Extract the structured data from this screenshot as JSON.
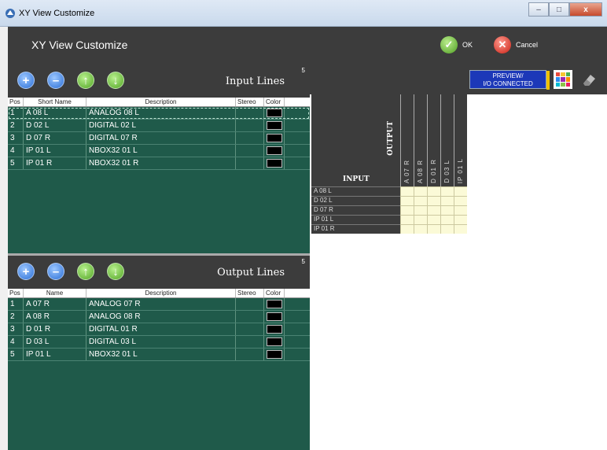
{
  "window": {
    "title": "XY View Customize",
    "controls": {
      "minimize": "–",
      "maximize": "□",
      "close": "x"
    }
  },
  "header": {
    "title": "XY View Customize",
    "ok_label": "OK",
    "cancel_label": "Cancel"
  },
  "input_panel": {
    "label": "Input Lines",
    "count": "5",
    "columns": [
      "Pos",
      "Short Name",
      "Description",
      "Stereo",
      "Color"
    ],
    "rows": [
      {
        "pos": "1",
        "name": "A 08 L",
        "desc": "ANALOG 08 L"
      },
      {
        "pos": "2",
        "name": "D 02 L",
        "desc": "DIGITAL 02 L"
      },
      {
        "pos": "3",
        "name": "D 07 R",
        "desc": "DIGITAL 07 R"
      },
      {
        "pos": "4",
        "name": "IP 01 L",
        "desc": "NBOX32 01 L"
      },
      {
        "pos": "5",
        "name": "IP 01 R",
        "desc": "NBOX32 01 R"
      }
    ]
  },
  "output_panel": {
    "label": "Output Lines",
    "count": "5",
    "columns": [
      "Pos",
      "Name",
      "Description",
      "Stereo",
      "Color"
    ],
    "rows": [
      {
        "pos": "1",
        "name": "A 07 R",
        "desc": "ANALOG 07 R"
      },
      {
        "pos": "2",
        "name": "A 08 R",
        "desc": "ANALOG 08 R"
      },
      {
        "pos": "3",
        "name": "D 01 R",
        "desc": "DIGITAL 01 R"
      },
      {
        "pos": "4",
        "name": "D 03 L",
        "desc": "DIGITAL 03 L"
      },
      {
        "pos": "5",
        "name": "IP 01 L",
        "desc": "NBOX32 01 L"
      }
    ]
  },
  "preview": {
    "line1": "PREVIEW/",
    "line2": "I/O CONNECTED"
  },
  "matrix": {
    "output_label": "OUTPUT",
    "input_label": "INPUT",
    "columns": [
      "A 07 R",
      "A 08 R",
      "D 01 R",
      "D 03 L",
      "IP 01 L"
    ],
    "rows": [
      "A 08 L",
      "D 02 L",
      "D 07 R",
      "IP 01 L",
      "IP 01 R"
    ]
  },
  "colors": {
    "grid_bg": "#1f5a4a",
    "toolbar_bg": "#3c3c3c",
    "matrix_cell": "#fbfad7",
    "preview_bg": "#1c38b8"
  }
}
